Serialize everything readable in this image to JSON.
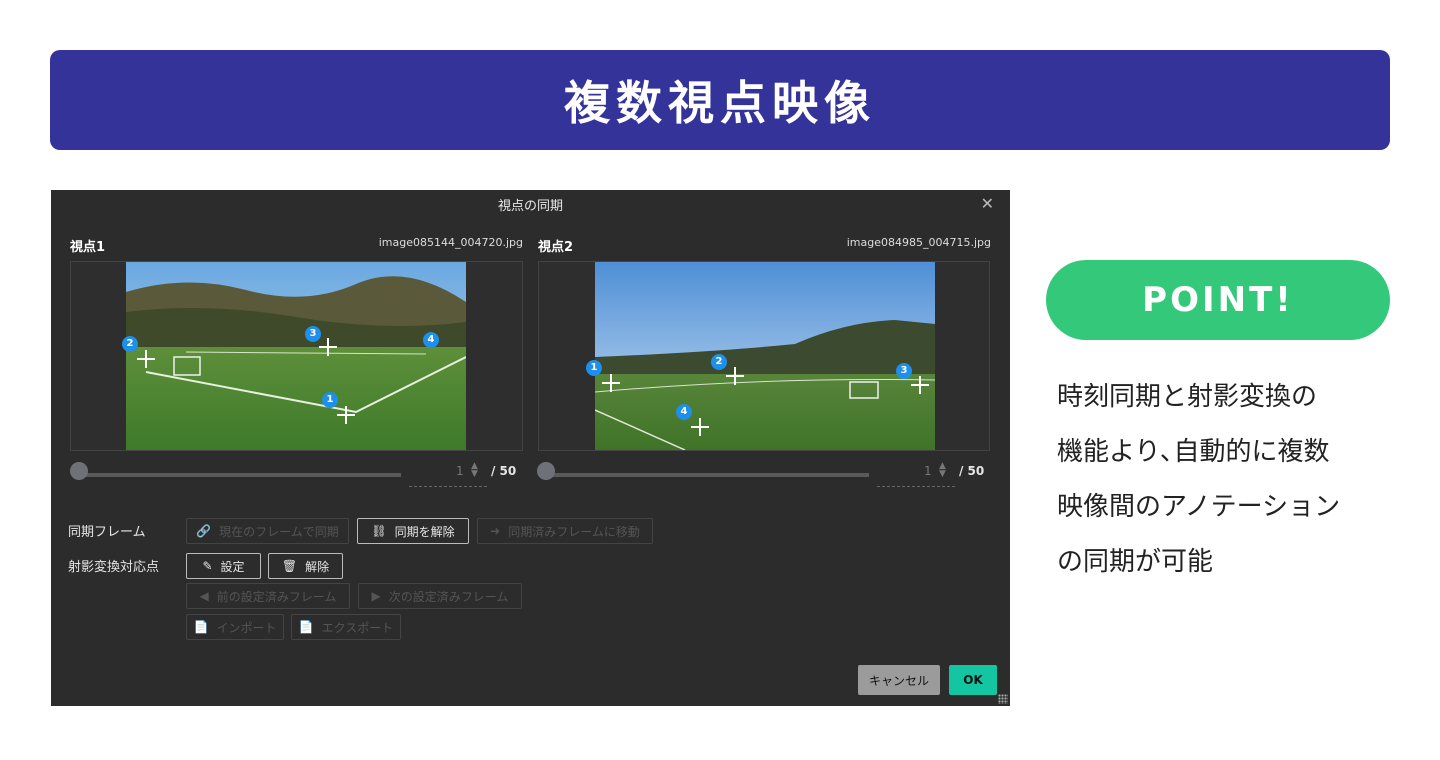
{
  "banner": {
    "title": "複数視点映像"
  },
  "dialog": {
    "title": "視点の同期",
    "view1": {
      "label": "視点1",
      "file": "image085144_004720.jpg",
      "frame": "1",
      "total": "/ 50",
      "markers": [
        "1",
        "2",
        "3",
        "4"
      ]
    },
    "view2": {
      "label": "視点2",
      "file": "image084985_004715.jpg",
      "frame": "1",
      "total": "/ 50",
      "markers": [
        "1",
        "2",
        "3",
        "4"
      ]
    },
    "sync_frame": {
      "label": "同期フレーム",
      "sync_current": "現在のフレームで同期",
      "unsync": "同期を解除",
      "goto_synced": "同期済みフレームに移動"
    },
    "projection": {
      "label": "射影変換対応点",
      "set": "設定",
      "clear": "解除",
      "prev_set": "前の設定済みフレーム",
      "next_set": "次の設定済みフレーム",
      "import": "インポート",
      "export": "エクスポート"
    },
    "cancel": "キャンセル",
    "ok": "OK"
  },
  "point": {
    "title": "POINT!",
    "lines": [
      "時刻同期と射影変換の",
      "機能より､自動的に複数",
      "映像間のアノテーション",
      "の同期が可能"
    ]
  }
}
